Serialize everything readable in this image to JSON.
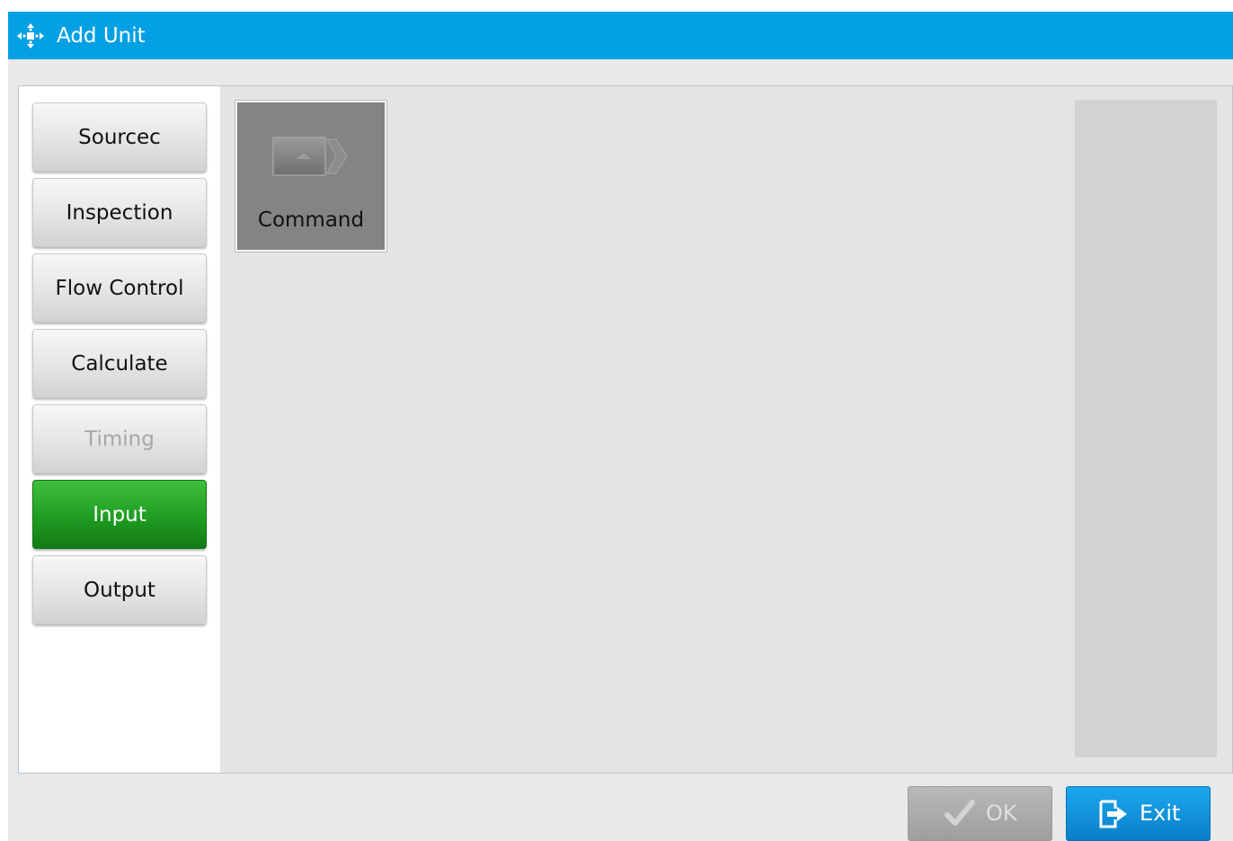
{
  "window": {
    "title": "Add Unit",
    "title_icon": "move-arrows-icon",
    "accent_color": "#03a0e3"
  },
  "categories": [
    {
      "label": "Sourcec",
      "state": "normal"
    },
    {
      "label": "Inspection",
      "state": "normal"
    },
    {
      "label": "Flow Control",
      "state": "normal"
    },
    {
      "label": "Calculate",
      "state": "normal"
    },
    {
      "label": "Timing",
      "state": "disabled"
    },
    {
      "label": "Input",
      "state": "selected"
    },
    {
      "label": "Output",
      "state": "normal"
    }
  ],
  "units": [
    {
      "label": "Command",
      "icon": "command-icon"
    }
  ],
  "footer": {
    "ok_label": "OK",
    "ok_icon": "checkmark-icon",
    "ok_enabled": false,
    "exit_label": "Exit",
    "exit_icon": "exit-door-icon"
  },
  "colors": {
    "selected": "#1f9d22",
    "exit_button": "#0a7fc8"
  }
}
